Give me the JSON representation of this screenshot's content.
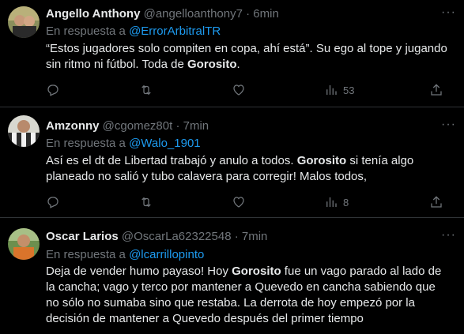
{
  "reply_prefix": "En respuesta a",
  "more_label": "···",
  "tweets": [
    {
      "name": "Angello Anthony",
      "handle": "@angelloanthony7",
      "sep": "·",
      "time": "6min",
      "reply_to": "@ErrorArbitralTR",
      "lines": [
        [
          "“Estos jugadores solo compiten en copa, ahí está”. Su ego al tope y jugando"
        ],
        [
          "sin ritmo ni fútbol. Toda de ",
          "Gorosito",
          "."
        ]
      ],
      "views": "53"
    },
    {
      "name": "Amzonny",
      "handle": "@cgomez80t",
      "sep": "·",
      "time": "7min",
      "reply_to": "@Walo_1901",
      "lines": [
        [
          "Así es el dt de Libertad trabajó y anulo a todos. ",
          "Gorosito",
          " si tenía algo"
        ],
        [
          "planeado no salió y tubo calavera para corregir! Malos todos,"
        ]
      ],
      "views": "8"
    },
    {
      "name": "Oscar Larios",
      "handle": "@OscarLa62322548",
      "sep": "·",
      "time": "7min",
      "reply_to": "@lcarrillopinto",
      "lines": [
        [
          "Deja de vender humo payaso! Hoy ",
          "Gorosito",
          " fue un vago parado al lado de"
        ],
        [
          "la cancha; vago y terco por mantener a Quevedo en cancha sabiendo que"
        ],
        [
          "no sólo no sumaba sino que restaba. La derrota de hoy empezó por la"
        ],
        [
          "decisión de mantener a Quevedo después del primer tiempo"
        ]
      ],
      "views": ""
    }
  ]
}
